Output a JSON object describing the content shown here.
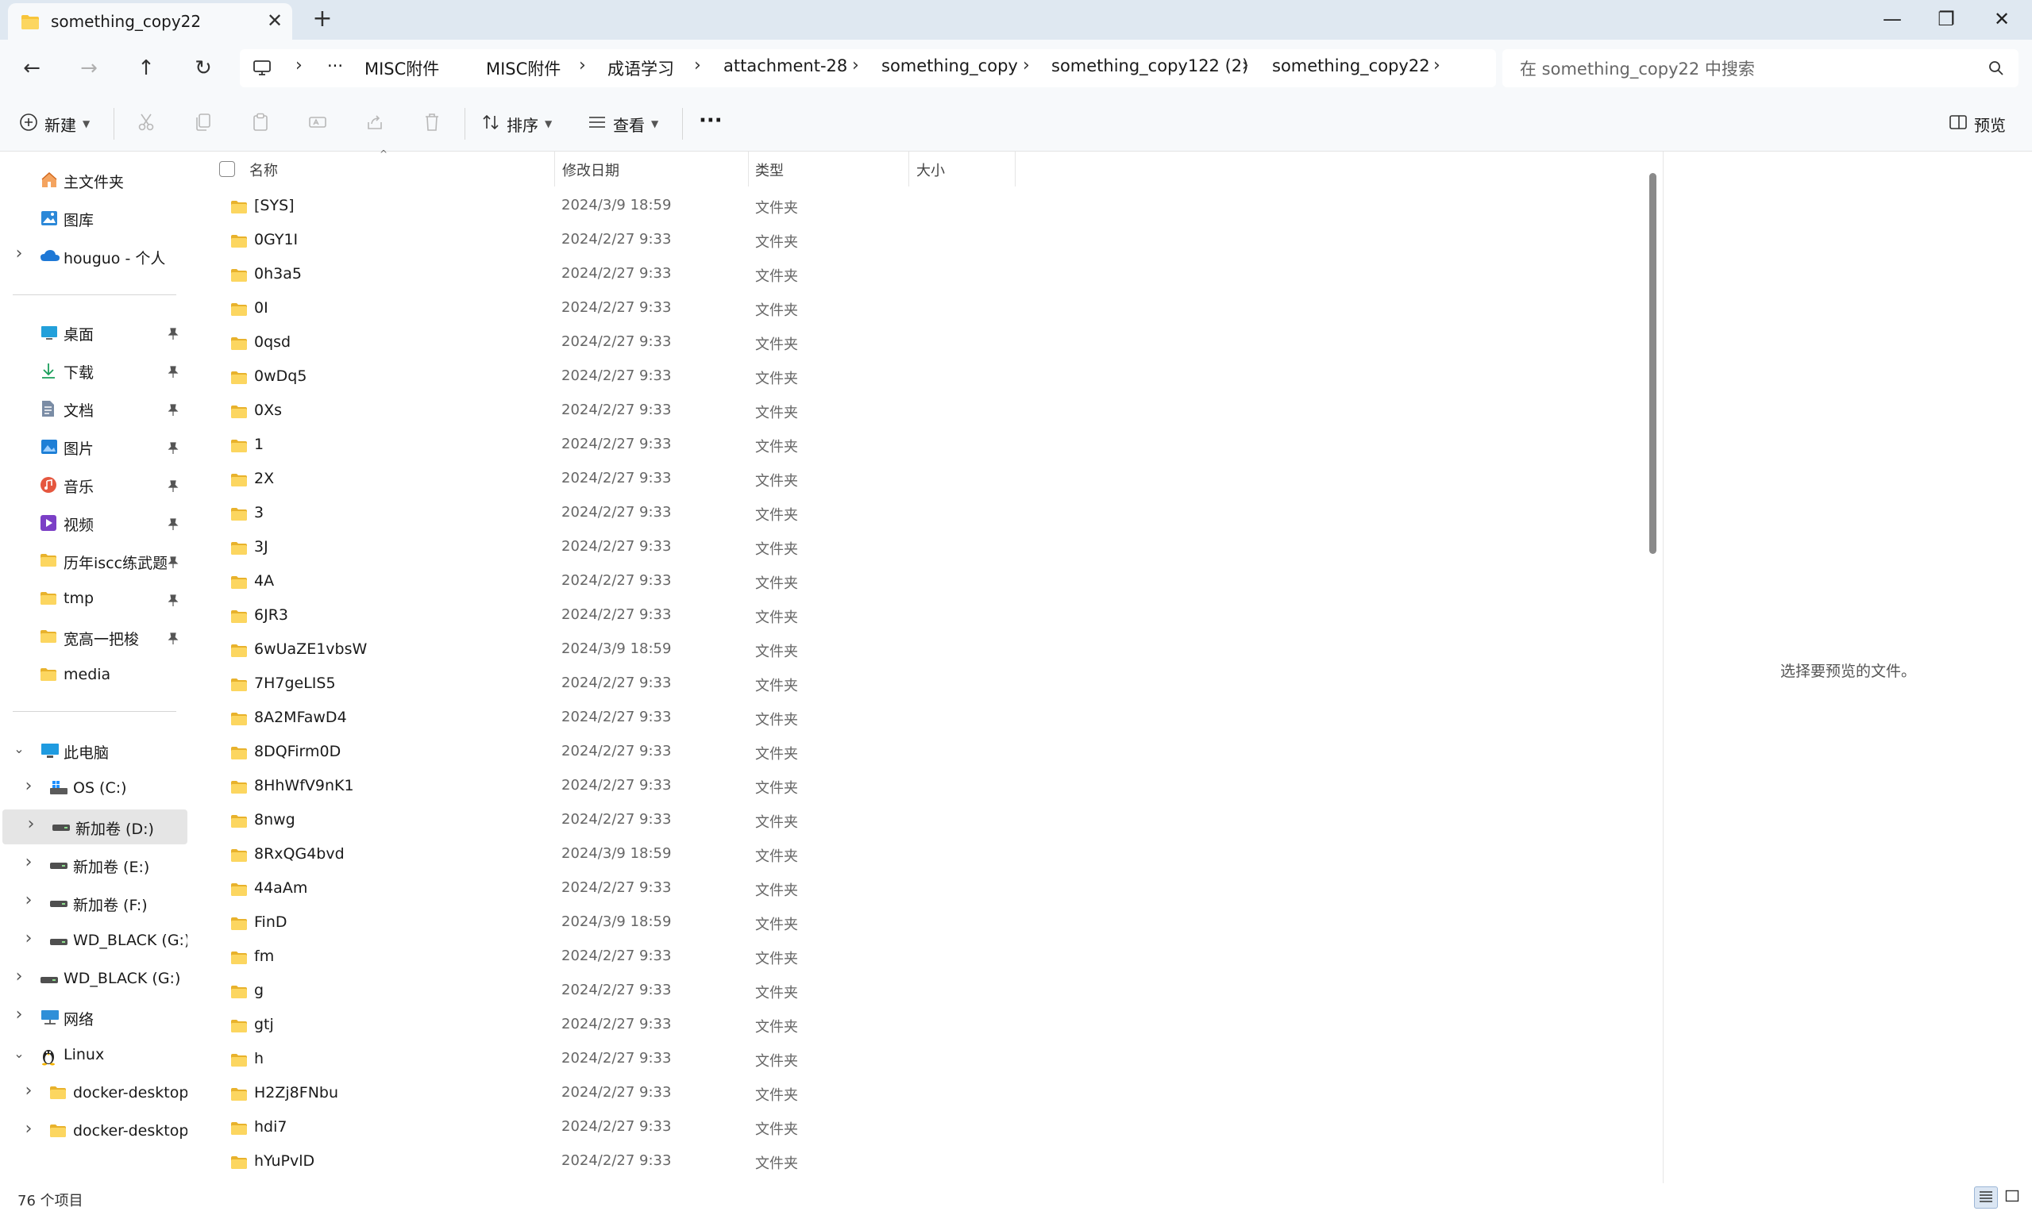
{
  "window": {
    "tab_title": "something_copy22",
    "tab_close_glyph": "✕",
    "new_tab_glyph": "+",
    "minimize_glyph": "—",
    "restore_glyph": "❐",
    "close_glyph": "✕"
  },
  "navigation": {
    "back_glyph": "←",
    "forward_glyph": "→",
    "up_glyph": "↑",
    "refresh_glyph": "↻",
    "overflow_glyph": "···",
    "separator_glyph": "›",
    "breadcrumbs": [
      "MISC附件",
      "MISC附件",
      "成语学习",
      "attachment-28",
      "something_copy",
      "something_copy122 (2)",
      "something_copy22"
    ]
  },
  "search": {
    "placeholder": "在 something_copy22 中搜索"
  },
  "commandbar": {
    "new_label": "新建",
    "sort_label": "排序",
    "view_label": "查看",
    "more_glyph": "···",
    "preview_label": "预览"
  },
  "sidebar": {
    "quick": [
      {
        "label": "主文件夹",
        "icon": "home-icon"
      },
      {
        "label": "图库",
        "icon": "gallery-icon"
      },
      {
        "label": "houguo - 个人",
        "icon": "cloud-icon"
      }
    ],
    "pinned": [
      {
        "label": "桌面",
        "icon": "desktop-icon"
      },
      {
        "label": "下载",
        "icon": "download-icon"
      },
      {
        "label": "文档",
        "icon": "document-icon"
      },
      {
        "label": "图片",
        "icon": "pictures-icon"
      },
      {
        "label": "音乐",
        "icon": "music-icon"
      },
      {
        "label": "视频",
        "icon": "video-icon"
      },
      {
        "label": "历年iscc练武题n",
        "icon": "folder-icon"
      },
      {
        "label": "tmp",
        "icon": "folder-icon"
      },
      {
        "label": "宽高一把梭",
        "icon": "folder-icon"
      },
      {
        "label": "media",
        "icon": "folder-icon"
      }
    ],
    "tree": [
      {
        "label": "此电脑",
        "icon": "computer-icon"
      },
      {
        "label": "OS (C:)",
        "icon": "windows-drive-icon"
      },
      {
        "label": "新加卷 (D:)",
        "icon": "drive-icon"
      },
      {
        "label": "新加卷 (E:)",
        "icon": "drive-icon"
      },
      {
        "label": "新加卷 (F:)",
        "icon": "drive-icon"
      },
      {
        "label": "WD_BLACK (G:)",
        "icon": "drive-icon"
      },
      {
        "label": "WD_BLACK (G:)",
        "icon": "drive-icon"
      },
      {
        "label": "网络",
        "icon": "network-icon"
      },
      {
        "label": "Linux",
        "icon": "linux-penguin-icon"
      },
      {
        "label": "docker-desktop",
        "icon": "folder-icon"
      },
      {
        "label": "docker-desktop-",
        "icon": "folder-icon"
      }
    ]
  },
  "filelist": {
    "columns": {
      "name": "名称",
      "date": "修改日期",
      "type": "类型",
      "size": "大小"
    },
    "rows": [
      {
        "name": "[SYS]",
        "date": "2024/3/9 18:59",
        "type": "文件夹",
        "size": ""
      },
      {
        "name": "0GY1I",
        "date": "2024/2/27 9:33",
        "type": "文件夹",
        "size": ""
      },
      {
        "name": "0h3a5",
        "date": "2024/2/27 9:33",
        "type": "文件夹",
        "size": ""
      },
      {
        "name": "0I",
        "date": "2024/2/27 9:33",
        "type": "文件夹",
        "size": ""
      },
      {
        "name": "0qsd",
        "date": "2024/2/27 9:33",
        "type": "文件夹",
        "size": ""
      },
      {
        "name": "0wDq5",
        "date": "2024/2/27 9:33",
        "type": "文件夹",
        "size": ""
      },
      {
        "name": "0Xs",
        "date": "2024/2/27 9:33",
        "type": "文件夹",
        "size": ""
      },
      {
        "name": "1",
        "date": "2024/2/27 9:33",
        "type": "文件夹",
        "size": ""
      },
      {
        "name": "2X",
        "date": "2024/2/27 9:33",
        "type": "文件夹",
        "size": ""
      },
      {
        "name": "3",
        "date": "2024/2/27 9:33",
        "type": "文件夹",
        "size": ""
      },
      {
        "name": "3J",
        "date": "2024/2/27 9:33",
        "type": "文件夹",
        "size": ""
      },
      {
        "name": "4A",
        "date": "2024/2/27 9:33",
        "type": "文件夹",
        "size": ""
      },
      {
        "name": "6JR3",
        "date": "2024/2/27 9:33",
        "type": "文件夹",
        "size": ""
      },
      {
        "name": "6wUaZE1vbsW",
        "date": "2024/3/9 18:59",
        "type": "文件夹",
        "size": ""
      },
      {
        "name": "7H7geLIS5",
        "date": "2024/2/27 9:33",
        "type": "文件夹",
        "size": ""
      },
      {
        "name": "8A2MFawD4",
        "date": "2024/2/27 9:33",
        "type": "文件夹",
        "size": ""
      },
      {
        "name": "8DQFirm0D",
        "date": "2024/2/27 9:33",
        "type": "文件夹",
        "size": ""
      },
      {
        "name": "8HhWfV9nK1",
        "date": "2024/2/27 9:33",
        "type": "文件夹",
        "size": ""
      },
      {
        "name": "8nwg",
        "date": "2024/2/27 9:33",
        "type": "文件夹",
        "size": ""
      },
      {
        "name": "8RxQG4bvd",
        "date": "2024/3/9 18:59",
        "type": "文件夹",
        "size": ""
      },
      {
        "name": "44aAm",
        "date": "2024/2/27 9:33",
        "type": "文件夹",
        "size": ""
      },
      {
        "name": "FinD",
        "date": "2024/3/9 18:59",
        "type": "文件夹",
        "size": ""
      },
      {
        "name": "fm",
        "date": "2024/2/27 9:33",
        "type": "文件夹",
        "size": ""
      },
      {
        "name": "g",
        "date": "2024/2/27 9:33",
        "type": "文件夹",
        "size": ""
      },
      {
        "name": "gtj",
        "date": "2024/2/27 9:33",
        "type": "文件夹",
        "size": ""
      },
      {
        "name": "h",
        "date": "2024/2/27 9:33",
        "type": "文件夹",
        "size": ""
      },
      {
        "name": "H2Zj8FNbu",
        "date": "2024/2/27 9:33",
        "type": "文件夹",
        "size": ""
      },
      {
        "name": "hdi7",
        "date": "2024/2/27 9:33",
        "type": "文件夹",
        "size": ""
      },
      {
        "name": "hYuPvlD",
        "date": "2024/2/27 9:33",
        "type": "文件夹",
        "size": ""
      }
    ]
  },
  "preview": {
    "empty_message": "选择要预览的文件。"
  },
  "status": {
    "item_count": "76 个项目"
  },
  "colors": {
    "titlebar_bg": "#dfe8f1",
    "toolbar_bg": "#f7f9fb",
    "folder_yellow": "#f8c53a",
    "selected_bg": "#e5e5e5"
  }
}
